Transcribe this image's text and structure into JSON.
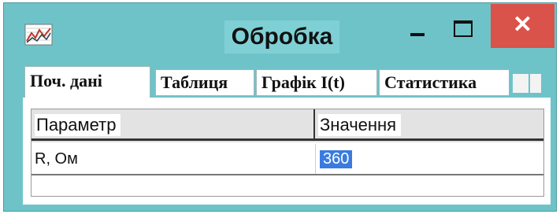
{
  "window": {
    "title": "Обробка",
    "icon": "chart-icon",
    "controls": {
      "minimize": "minimize-icon",
      "maximize": "maximize-icon",
      "close_label": "✕"
    }
  },
  "tabs": [
    {
      "label": "Поч. дані",
      "active": true
    },
    {
      "label": "Таблиця",
      "active": false
    },
    {
      "label": "Графік I(t)",
      "active": false
    },
    {
      "label": "Статистика",
      "active": false
    }
  ],
  "grid": {
    "columns": [
      "Параметр",
      "Значення"
    ],
    "rows": [
      {
        "param": "R, Ом",
        "value": "360",
        "value_selected": true
      }
    ]
  },
  "colors": {
    "window_bg": "#6ec3c9",
    "close_button": "#d9534a",
    "selection": "#3a7be0"
  }
}
